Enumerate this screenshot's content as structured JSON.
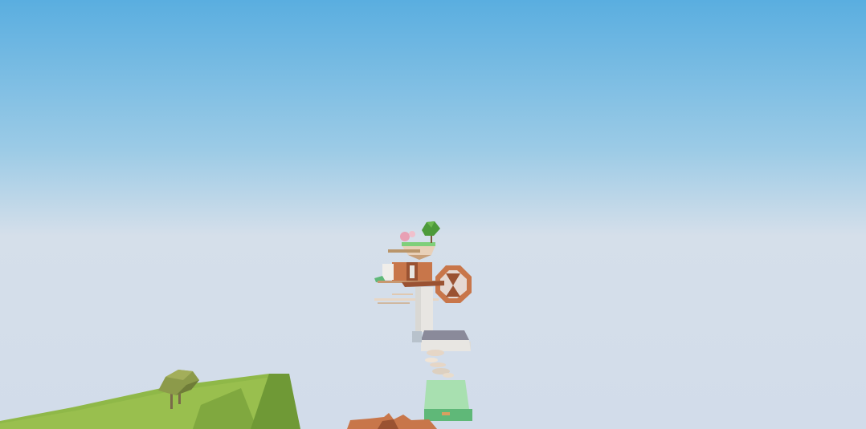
{
  "scene": {
    "view": "first-person",
    "sky": {
      "top_color": "#5aaee0",
      "mid_color": "#9ccbe6",
      "horizon_color": "#d5dfea",
      "bottom_color": "#d2dcea"
    },
    "colors": {
      "grass_light": "#8fb848",
      "grass_side": "#a2c553",
      "grass_dark": "#6f9936",
      "tree_foliage": "#8c9a4a",
      "tree_trunk": "#7a6a4a",
      "wood": "#c8764a",
      "wood_dark": "#9a5232",
      "stone_white": "#e8e6e2",
      "stone_gray": "#8a8a9a",
      "mint": "#a8e0b0",
      "mint_dark": "#5fb878",
      "pink": "#e8a0b4",
      "green_tree": "#4d9a3a",
      "sand": "#e8d0b8"
    },
    "objects": [
      {
        "name": "grass-island",
        "kind": "terrain"
      },
      {
        "name": "lowpoly-tree",
        "kind": "decoration"
      },
      {
        "name": "floating-island-top",
        "kind": "platform"
      },
      {
        "name": "wooden-crate-block",
        "kind": "platform"
      },
      {
        "name": "wooden-wheel",
        "kind": "obstacle"
      },
      {
        "name": "green-ledge",
        "kind": "platform"
      },
      {
        "name": "rope-bridge",
        "kind": "platform"
      },
      {
        "name": "white-pillar",
        "kind": "platform"
      },
      {
        "name": "gray-stone-platform",
        "kind": "platform"
      },
      {
        "name": "stone-steps",
        "kind": "platform"
      },
      {
        "name": "mint-platform",
        "kind": "platform"
      },
      {
        "name": "wooden-start-platform",
        "kind": "platform"
      }
    ]
  }
}
